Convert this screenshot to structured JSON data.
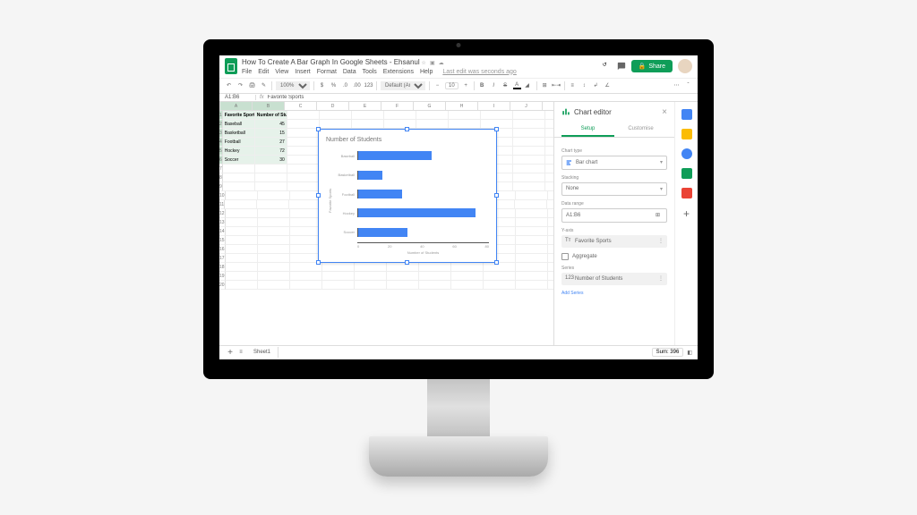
{
  "doc_title": "How To Create A Bar Graph In Google Sheets - Ehsanul",
  "last_edit": "Last edit was seconds ago",
  "menus": [
    "File",
    "Edit",
    "View",
    "Insert",
    "Format",
    "Data",
    "Tools",
    "Extensions",
    "Help"
  ],
  "share_label": "Share",
  "toolbar": {
    "zoom": "100%",
    "format_currency": "$",
    "format_percent": "%",
    "decimal_dec": ".0",
    "decimal_inc": ".00",
    "more_formats": "123",
    "font": "Default (Ari...",
    "font_size": "10"
  },
  "name_box": "A1:B6",
  "fx": "fx",
  "formula": "Favorite Sports",
  "columns": [
    "A",
    "B",
    "C",
    "D",
    "E",
    "F",
    "G",
    "H",
    "I",
    "J",
    "K"
  ],
  "rows": 20,
  "data": {
    "headers": [
      "Favorite Sports",
      "Number of Students"
    ],
    "rows": [
      [
        "Baseball",
        45
      ],
      [
        "Basketball",
        15
      ],
      [
        "Football",
        27
      ],
      [
        "Hockey",
        72
      ],
      [
        "Soccer",
        30
      ]
    ]
  },
  "chart_data": {
    "type": "bar",
    "title": "Number of Students",
    "categories": [
      "Baseball",
      "Basketball",
      "Football",
      "Hockey",
      "Soccer"
    ],
    "values": [
      45,
      15,
      27,
      72,
      30
    ],
    "xlabel": "Number of Students",
    "ylabel": "Favorite Sports",
    "xlim": [
      0,
      80
    ],
    "ticks": [
      0,
      20,
      40,
      60,
      80
    ]
  },
  "editor": {
    "title": "Chart editor",
    "tabs": {
      "setup": "Setup",
      "customize": "Customise"
    },
    "chart_type_label": "Chart type",
    "chart_type_value": "Bar chart",
    "stacking_label": "Stacking",
    "stacking_value": "None",
    "data_range_label": "Data range",
    "data_range_value": "A1:B6",
    "yaxis_label": "Y-axis",
    "yaxis_value": "Favorite Sports",
    "aggregate": "Aggregate",
    "series_label": "Series",
    "series_value": "Number of Students",
    "add_series": "Add Series"
  },
  "bottom": {
    "sheet_tab": "Sheet1",
    "sum": "Sum: 396",
    "explore": "Explore"
  }
}
